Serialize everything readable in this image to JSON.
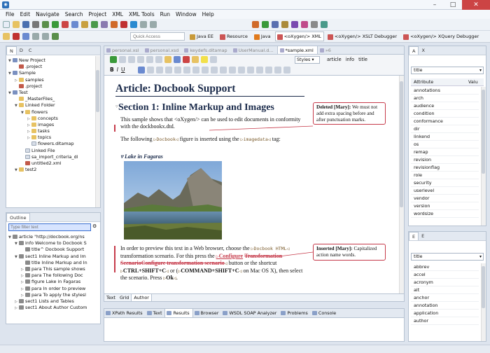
{
  "window": {
    "title_icon": "oxygen-app-icon"
  },
  "menu": [
    "File",
    "Edit",
    "Navigate",
    "Search",
    "Project",
    "XML",
    "XML Tools",
    "Run",
    "Window",
    "Help"
  ],
  "quick_access": {
    "placeholder": "Quick Access"
  },
  "perspectives": [
    {
      "label": "Java EE",
      "active": false
    },
    {
      "label": "Resource",
      "active": false
    },
    {
      "label": "Java",
      "active": false
    },
    {
      "label": "<oXygen/> XML",
      "active": true
    },
    {
      "label": "<oXygen/> XSLT Debugger",
      "active": false
    },
    {
      "label": "<oXygen/> XQuery Debugger",
      "active": false
    }
  ],
  "navigator": {
    "tabs": [
      "N",
      "D",
      "C"
    ],
    "rows": [
      {
        "text": "New Project",
        "indent": 0,
        "type": "prj",
        "exp": "▼"
      },
      {
        "text": ".project",
        "indent": 1,
        "type": "xml",
        "exp": ""
      },
      {
        "text": "Sample",
        "indent": 0,
        "type": "prj",
        "exp": "▼"
      },
      {
        "text": "samples",
        "indent": 1,
        "type": "fold",
        "exp": "▷"
      },
      {
        "text": ".project",
        "indent": 1,
        "type": "xml",
        "exp": ""
      },
      {
        "text": "Test",
        "indent": 0,
        "type": "prj",
        "exp": "▼"
      },
      {
        "text": "_MasterFiles_",
        "indent": 1,
        "type": "fold",
        "exp": ""
      },
      {
        "text": "Linked Folder",
        "indent": 1,
        "type": "fold",
        "exp": "▼"
      },
      {
        "text": "flowers",
        "indent": 2,
        "type": "fold",
        "exp": "▼"
      },
      {
        "text": "concepts",
        "indent": 3,
        "type": "fold",
        "exp": "▷"
      },
      {
        "text": "images",
        "indent": 3,
        "type": "fold",
        "exp": "▷"
      },
      {
        "text": "tasks",
        "indent": 3,
        "type": "fold",
        "exp": "▷"
      },
      {
        "text": "topics",
        "indent": 3,
        "type": "fold",
        "exp": "▷"
      },
      {
        "text": "flowers.ditamap",
        "indent": 3,
        "type": "fil",
        "exp": ""
      },
      {
        "text": "Linked File",
        "indent": 2,
        "type": "fil",
        "exp": ""
      },
      {
        "text": "sa_import_criteria_dl",
        "indent": 2,
        "type": "fil",
        "exp": ""
      },
      {
        "text": "untitled2.xml",
        "indent": 2,
        "type": "xml",
        "exp": ""
      },
      {
        "text": "test2",
        "indent": 1,
        "type": "fold",
        "exp": "▼"
      }
    ]
  },
  "outline": {
    "title": "Outline",
    "filter_placeholder": "Type filter text",
    "rows": [
      {
        "text": "article  \"http://docbook.org/ns",
        "indent": 0,
        "exp": "▼"
      },
      {
        "text": "info  Welcome to Docbook S",
        "indent": 1,
        "exp": "▼"
      },
      {
        "text": "title^ Docbook Support",
        "indent": 2,
        "exp": ""
      },
      {
        "text": "sect1  Inline Markup and Im",
        "indent": 1,
        "exp": "▼"
      },
      {
        "text": "title  Inline Markup and In",
        "indent": 2,
        "exp": ""
      },
      {
        "text": "para  This sample shows",
        "indent": 2,
        "exp": "▷"
      },
      {
        "text": "para  The following Doc",
        "indent": 2,
        "exp": "▷"
      },
      {
        "text": "figure  Lake in Fagaras",
        "indent": 2,
        "exp": "▷"
      },
      {
        "text": "para  In order to preview",
        "indent": 2,
        "exp": "▷"
      },
      {
        "text": "para  To apply the stylesl",
        "indent": 2,
        "exp": "▷"
      },
      {
        "text": "sect1  Lists and Tables",
        "indent": 1,
        "exp": "▷"
      },
      {
        "text": "sect1  About Author Custom",
        "indent": 1,
        "exp": "▷"
      }
    ]
  },
  "editor": {
    "tabs": [
      {
        "label": "personal.xsl",
        "selected": false
      },
      {
        "label": "personal.xsd",
        "selected": false
      },
      {
        "label": "keydefs.ditamap",
        "selected": false
      },
      {
        "label": "UserManual.d...",
        "selected": false
      },
      {
        "label": "*sample.xml",
        "selected": true
      },
      {
        "label": "»6",
        "selected": false
      }
    ],
    "toolbar_styles": "Styles",
    "breadcrumb": [
      "article",
      "info",
      "title"
    ],
    "article_title": "Article: Docbook Support",
    "section_title": "Section 1: Inline Markup and Images",
    "para1": "This sample shows that <oXygen/> can be used to edit documents in conformity with the dockbookx.dtd.",
    "para2_a": "The following",
    "para2_tag": "Docbook",
    "para2_b": "figure is inserted using the",
    "para2_tag2": "imagedata",
    "para2_c": "tag:",
    "figure_title": "Lake in Fagaras",
    "para3_a": "In order to preview this text in a Web browser, choose the",
    "para3_code": "Docbook HTML",
    "para3_b": "transformation scenario. For this press the",
    "para3_ins": "Configure",
    "para3_del": "Transformation ScenarioConfigure transformation scenario",
    "para3_c": "button or the shortcut",
    "para3_k1": "CTRL+SHIFT+C",
    "para3_d": "or (",
    "para3_k2": "COMMAND+SHIFT+C",
    "para3_e": "on Mac OS X), then select the scenario. Press",
    "para3_k3": "Ok",
    "para3_f": ".",
    "comment1_author": "Deleted [Mary]:",
    "comment1_text": "We must not add extra spacing before and after punctuation marks.",
    "comment2_author": "Inserted [Mary]:",
    "comment2_text": "Capitalized action name words.",
    "mode_tabs": [
      "Text",
      "Grid",
      "Author"
    ]
  },
  "bottom_views": [
    "XPath Results",
    "Text",
    "Results",
    "Browser",
    "WSDL SOAP Analyzer",
    "Problems",
    "Console"
  ],
  "attributes": {
    "tab": "A",
    "element": "title",
    "col_attr": "Attribute",
    "col_val": "Valu",
    "rows": [
      "annotations",
      "arch",
      "audience",
      "condition",
      "conformance",
      "dir",
      "linkend",
      "os",
      "remap",
      "revision",
      "revisionflag",
      "role",
      "security",
      "userlevel",
      "vendor",
      "version",
      "wordsize"
    ]
  },
  "elements": {
    "tab": "E",
    "element": "title",
    "rows": [
      "abbrev",
      "accel",
      "acronym",
      "alt",
      "anchor",
      "annotation",
      "application",
      "author"
    ]
  }
}
